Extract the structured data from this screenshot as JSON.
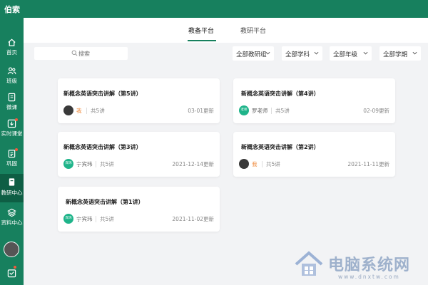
{
  "app": {
    "title": "伯索"
  },
  "sidebar": {
    "items": [
      {
        "label": "首页",
        "icon": "home-icon",
        "badge": false
      },
      {
        "label": "班级",
        "icon": "users-icon",
        "badge": false
      },
      {
        "label": "微课",
        "icon": "book-icon",
        "badge": false
      },
      {
        "label": "实时课堂",
        "icon": "download-icon",
        "badge": true
      },
      {
        "label": "巩固",
        "icon": "clipboard-icon",
        "badge": true
      },
      {
        "label": "教研中心",
        "icon": "research-icon",
        "badge": false,
        "active": true
      },
      {
        "label": "资料中心",
        "icon": "layers-icon",
        "badge": false
      }
    ],
    "message_badge": true
  },
  "tabs": [
    {
      "label": "教备平台",
      "active": true
    },
    {
      "label": "教研平台",
      "active": false
    }
  ],
  "search": {
    "placeholder": "搜索"
  },
  "filters": [
    {
      "value": "全部教研组"
    },
    {
      "value": "全部学科"
    },
    {
      "value": "全部年级"
    },
    {
      "value": "全部学期"
    }
  ],
  "cards": [
    {
      "title": "新概念英语突击讲解（第5讲）",
      "author": "我",
      "avatar_text": "",
      "count": "共5讲",
      "date": "03-01更新"
    },
    {
      "title": "新概念英语突击讲解（第4讲）",
      "author": "罗老师",
      "avatar_text": "老师",
      "count": "共5讲",
      "date": "02-09更新"
    },
    {
      "title": "新概念英语突击讲解（第3讲）",
      "author": "宁宾玮",
      "avatar_text": "宾玮",
      "count": "共5讲",
      "date": "2021-12-14更新"
    },
    {
      "title": "新概念英语突击讲解（第2讲）",
      "author": "我",
      "avatar_text": "",
      "count": "共5讲",
      "date": "2021-11-11更新"
    },
    {
      "title": "新概念英语突击讲解（第1讲）",
      "author": "宁宾玮",
      "avatar_text": "宾玮",
      "count": "共5讲",
      "date": "2021-11-02更新"
    }
  ],
  "watermark": {
    "text": "电脑系统网",
    "url": "www.dnxtw.com"
  },
  "colors": {
    "brand": "#17805e",
    "brand_dark": "#0e5e44",
    "badge": "#f05a3c",
    "me": "#ef8a3c",
    "teal_avatar": "#1fb48a"
  }
}
